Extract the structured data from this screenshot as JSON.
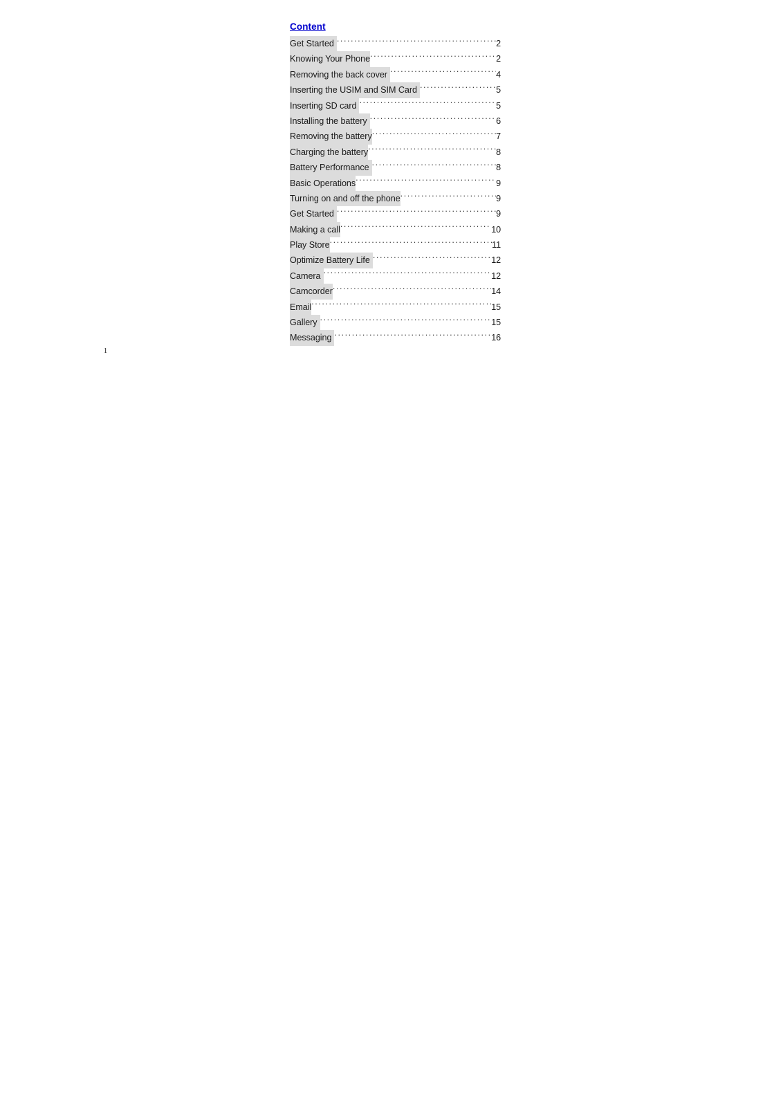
{
  "document": {
    "heading": "Content",
    "page_number": "1",
    "accent_link_color": "#0000CD",
    "highlight_color": "#dcdcdc",
    "paper_color": "#ffffff"
  },
  "toc": {
    "entries": [
      {
        "title": "Get Started ",
        "page": "2",
        "trailing_space": true
      },
      {
        "title": "Knowing Your Phone",
        "page": "2",
        "trailing_space": false
      },
      {
        "title": "Removing the back cover ",
        "page": "4",
        "trailing_space": true
      },
      {
        "title": "Inserting the USIM and SIM Card ",
        "page": "5",
        "trailing_space": true
      },
      {
        "title": "Inserting SD card ",
        "page": "5",
        "trailing_space": true
      },
      {
        "title": "Installing the battery ",
        "page": "6",
        "trailing_space": true
      },
      {
        "title": "Removing the battery",
        "page": "7",
        "trailing_space": false
      },
      {
        "title": "Charging the battery",
        "page": "8",
        "trailing_space": false
      },
      {
        "title": "Battery Performance ",
        "page": "8",
        "trailing_space": true
      },
      {
        "title": "Basic Operations",
        "page": "9",
        "trailing_space": false
      },
      {
        "title": "Turning on and off the phone",
        "page": "9",
        "trailing_space": false
      },
      {
        "title": "Get Started ",
        "page": "9",
        "trailing_space": true
      },
      {
        "title": "Making a call",
        "page": "10",
        "trailing_space": false
      },
      {
        "title": "Play Store",
        "page": "11",
        "trailing_space": false
      },
      {
        "title": "Optimize Battery Life ",
        "page": "12",
        "trailing_space": true
      },
      {
        "title": "Camera ",
        "page": "12",
        "trailing_space": true
      },
      {
        "title": "Camcorder",
        "page": "14",
        "trailing_space": false
      },
      {
        "title": "Email",
        "page": "15",
        "trailing_space": false
      },
      {
        "title": "Gallery ",
        "page": "15",
        "trailing_space": true
      },
      {
        "title": "Messaging ",
        "page": "16",
        "trailing_space": true
      }
    ]
  }
}
